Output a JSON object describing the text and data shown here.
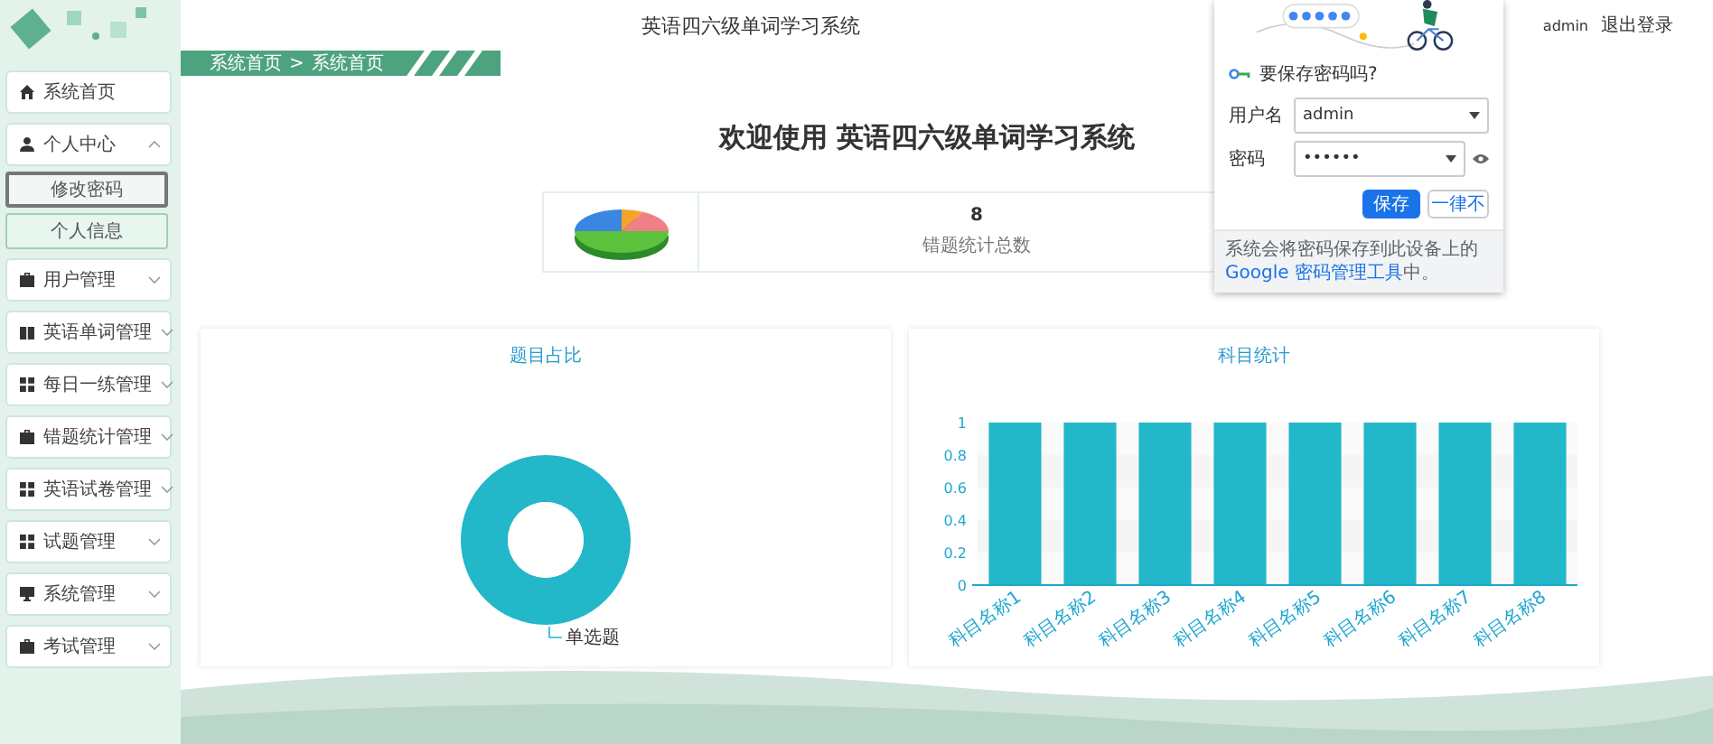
{
  "header": {
    "title": "英语四六级单词学习系统",
    "user": "admin",
    "logout": "退出登录"
  },
  "sidebar": {
    "items": [
      {
        "label": "系统首页",
        "kind": "link"
      },
      {
        "label": "个人中心",
        "kind": "menu",
        "expanded": true,
        "children": [
          {
            "label": "修改密码",
            "selected": true
          },
          {
            "label": "个人信息",
            "selected": false
          }
        ]
      },
      {
        "label": "用户管理",
        "kind": "menu",
        "expanded": false
      },
      {
        "label": "英语单词管理",
        "kind": "menu",
        "expanded": false
      },
      {
        "label": "每日一练管理",
        "kind": "menu",
        "expanded": false
      },
      {
        "label": "错题统计管理",
        "kind": "menu",
        "expanded": false
      },
      {
        "label": "英语试卷管理",
        "kind": "menu",
        "expanded": false
      },
      {
        "label": "试题管理",
        "kind": "menu",
        "expanded": false
      },
      {
        "label": "系统管理",
        "kind": "menu",
        "expanded": false
      },
      {
        "label": "考试管理",
        "kind": "menu",
        "expanded": false
      }
    ]
  },
  "breadcrumb": {
    "items": [
      "系统首页",
      "系统首页"
    ],
    "separator": ">"
  },
  "welcome": "欢迎使用 英语四六级单词学习系统",
  "stats": [
    {
      "value": "8",
      "label": "错题统计总数"
    }
  ],
  "charts": [
    {
      "chart_data": {
        "type": "donut",
        "title": "题目占比",
        "categories": [
          "单选题"
        ],
        "values": [
          1
        ]
      }
    },
    {
      "chart_data": {
        "type": "bar",
        "title": "科目统计",
        "categories": [
          "科目名称1",
          "科目名称2",
          "科目名称3",
          "科目名称4",
          "科目名称5",
          "科目名称6",
          "科目名称7",
          "科目名称8"
        ],
        "values": [
          1,
          1,
          1,
          1,
          1,
          1,
          1,
          1
        ],
        "ylim": [
          0,
          1
        ],
        "yticks": [
          0,
          0.2,
          0.4,
          0.6,
          0.8,
          1
        ]
      }
    }
  ],
  "password_prompt": {
    "title": "要保存密码吗?",
    "username_label": "用户名",
    "username": "admin",
    "password_label": "密码",
    "password": "••••••",
    "save": "保存",
    "never": "一律不",
    "note": "系统会将密码保存到此设备上的 **Google 密码管理工具**中。"
  }
}
